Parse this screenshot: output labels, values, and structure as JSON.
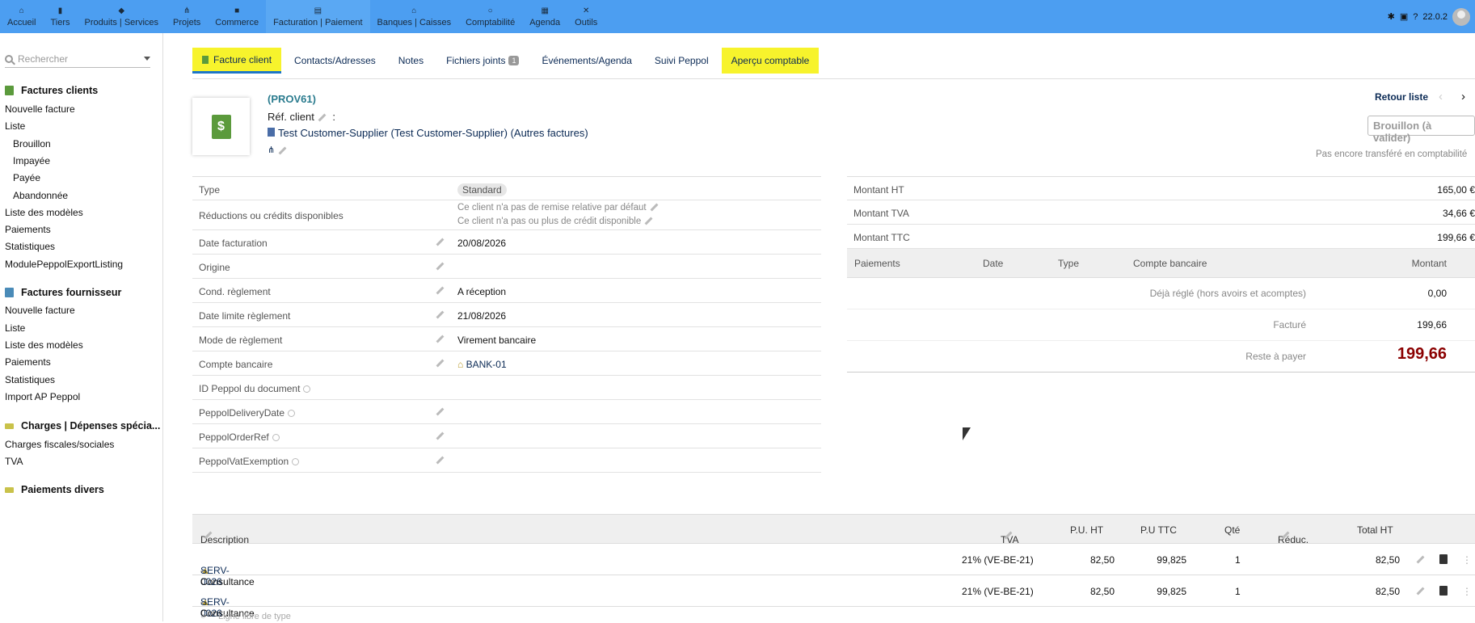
{
  "topmenu": [
    {
      "label": "Accueil",
      "icon": "home-icon"
    },
    {
      "label": "Tiers",
      "icon": "building-icon"
    },
    {
      "label": "Produits | Services",
      "icon": "cube-icon"
    },
    {
      "label": "Projets",
      "icon": "sitemap-icon"
    },
    {
      "label": "Commerce",
      "icon": "briefcase-icon"
    },
    {
      "label": "Facturation | Paiement",
      "icon": "file-invoice-icon"
    },
    {
      "label": "Banques | Caisses",
      "icon": "bank-icon"
    },
    {
      "label": "Comptabilité",
      "icon": "search-dollar-icon"
    },
    {
      "label": "Agenda",
      "icon": "calendar-icon"
    },
    {
      "label": "Outils",
      "icon": "tools-icon"
    }
  ],
  "topright": {
    "version": "22.0.2"
  },
  "sidebar": {
    "search_placeholder": "Rechercher",
    "items": [
      {
        "label": "Factures clients"
      },
      {
        "label": "Nouvelle facture"
      },
      {
        "label": "Liste"
      },
      {
        "label": "Brouillon"
      },
      {
        "label": "Impayée"
      },
      {
        "label": "Payée"
      },
      {
        "label": "Abandonnée"
      },
      {
        "label": "Liste des modèles"
      },
      {
        "label": "Paiements"
      },
      {
        "label": "Statistiques"
      },
      {
        "label": "ModulePeppolExportListing"
      },
      {
        "label": "Factures fournisseur"
      },
      {
        "label": "Nouvelle facture"
      },
      {
        "label": "Liste"
      },
      {
        "label": "Liste des modèles"
      },
      {
        "label": "Paiements"
      },
      {
        "label": "Statistiques"
      },
      {
        "label": "Import AP Peppol"
      },
      {
        "label": "Charges | Dépenses spécia..."
      },
      {
        "label": "Charges fiscales/sociales"
      },
      {
        "label": "TVA"
      },
      {
        "label": "Paiements divers"
      }
    ]
  },
  "tabs": [
    {
      "label": "Facture client"
    },
    {
      "label": "Contacts/Adresses"
    },
    {
      "label": "Notes"
    },
    {
      "label": "Fichiers joints",
      "badge": "1"
    },
    {
      "label": "Événements/Agenda"
    },
    {
      "label": "Suivi Peppol"
    },
    {
      "label": "Aperçu comptable"
    }
  ],
  "header": {
    "ref": "(PROV61)",
    "ref_client": "Réf. client",
    "thirdparty": "Test Customer-Supplier (Test Customer-Supplier)",
    "other": "(Autres factures)",
    "retour": "Retour liste",
    "status": "Brouillon (à valider)",
    "compta": "Pas encore transféré en comptabilité"
  },
  "fields": [
    {
      "label": "Type",
      "value": "Standard"
    },
    {
      "label": "Réductions ou crédits disponibles",
      "value": "Ce client n'a pas de remise relative par défaut",
      "value2": "Ce client n'a pas ou plus de crédit disponible"
    },
    {
      "label": "Date facturation",
      "value": "20/08/2026"
    },
    {
      "label": "Origine",
      "value": ""
    },
    {
      "label": "Cond. règlement",
      "value": "A réception"
    },
    {
      "label": "Date limite règlement",
      "value": "21/08/2026"
    },
    {
      "label": "Mode de règlement",
      "value": "Virement bancaire"
    },
    {
      "label": "Compte bancaire",
      "value": "BANK-01"
    },
    {
      "label": "ID Peppol du document",
      "value": ""
    },
    {
      "label": "PeppolDeliveryDate",
      "value": ""
    },
    {
      "label": "PeppolOrderRef",
      "value": ""
    },
    {
      "label": "PeppolVatExemption",
      "value": ""
    }
  ],
  "amounts": [
    {
      "label": "Montant HT",
      "value": "165,00 €"
    },
    {
      "label": "Montant TVA",
      "value": "34,66 €"
    },
    {
      "label": "Montant TTC",
      "value": "199,66 €"
    }
  ],
  "payments": {
    "headers": [
      "Paiements",
      "Date",
      "Type",
      "Compte bancaire",
      "Montant"
    ],
    "rows": [
      {
        "label": "Déjà réglé (hors avoirs et acomptes)",
        "value": "0,00"
      },
      {
        "label": "Facturé",
        "value": "199,66"
      },
      {
        "label": "Reste à payer",
        "value": "199,66"
      }
    ]
  },
  "lines": {
    "headers": {
      "desc": "Description",
      "tva": "TVA",
      "puht": "P.U. HT",
      "puttc": "P.U TTC",
      "qty": "Qté",
      "reduc": "Réduc.",
      "total": "Total HT"
    },
    "rows": [
      {
        "ref": "SERV-0026",
        "label": " - Consultance",
        "tva": "21% (VE-BE-21)",
        "puht": "82,50",
        "puttc": "99,825",
        "qty": "1",
        "total": "82,50"
      },
      {
        "ref": "SERV-0026",
        "label": " - Consultance",
        "tva": "21% (VE-BE-21)",
        "puht": "82,50",
        "puttc": "99,825",
        "qty": "1",
        "total": "82,50"
      }
    ],
    "free_line": "Ligne libre de type"
  }
}
